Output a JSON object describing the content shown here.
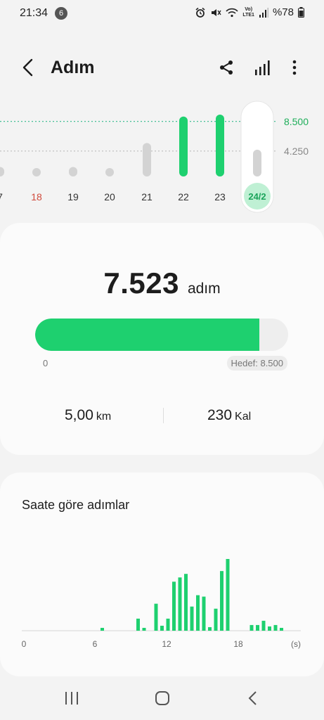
{
  "status_bar": {
    "time": "21:34",
    "notification_count": "6",
    "network_label_top": "Vo)",
    "network_label_bottom": "LTE1",
    "battery": "%78"
  },
  "header": {
    "title": "Adım",
    "icons": [
      "back-icon",
      "share-icon",
      "bar-chart-icon",
      "more-vert-icon"
    ]
  },
  "week_chart": {
    "goal_label": "8.500",
    "half_goal_label": "4.250",
    "days": [
      {
        "label": "7",
        "value": 1500,
        "color": "#d3d3d3",
        "label_color": "#333333"
      },
      {
        "label": "18",
        "value": 300,
        "color": "#d3d3d3",
        "label_color": "#d04a3c"
      },
      {
        "label": "19",
        "value": 1500,
        "color": "#d3d3d3",
        "label_color": "#333333"
      },
      {
        "label": "20",
        "value": 300,
        "color": "#d3d3d3",
        "label_color": "#333333"
      },
      {
        "label": "21",
        "value": 5300,
        "color": "#d3d3d3",
        "label_color": "#333333"
      },
      {
        "label": "22",
        "value": 9500,
        "color": "#1ed06f",
        "label_color": "#333333"
      },
      {
        "label": "23",
        "value": 9800,
        "color": "#1ed06f",
        "label_color": "#333333"
      }
    ],
    "selected": {
      "label": "24/2",
      "value": 5300
    }
  },
  "summary": {
    "steps": "7.523",
    "steps_unit": "adım",
    "progress_fraction": 0.885,
    "progress_min_label": "0",
    "progress_goal_label": "Hedef: 8.500",
    "distance_value": "5,00",
    "distance_unit": "km",
    "calories_value": "230",
    "calories_unit": "Kal"
  },
  "hourly": {
    "title": "Saate göre adımlar",
    "x_ticks": [
      "0",
      "6",
      "12",
      "18",
      "(s)"
    ],
    "bars": [
      {
        "hour": 6.5,
        "value": 4
      },
      {
        "hour": 9.5,
        "value": 17
      },
      {
        "hour": 10.0,
        "value": 4
      },
      {
        "hour": 11.0,
        "value": 38
      },
      {
        "hour": 11.5,
        "value": 7
      },
      {
        "hour": 12.0,
        "value": 17
      },
      {
        "hour": 12.5,
        "value": 69
      },
      {
        "hour": 13.0,
        "value": 75
      },
      {
        "hour": 13.5,
        "value": 80
      },
      {
        "hour": 14.0,
        "value": 34
      },
      {
        "hour": 14.5,
        "value": 50
      },
      {
        "hour": 15.0,
        "value": 48
      },
      {
        "hour": 15.5,
        "value": 5
      },
      {
        "hour": 16.0,
        "value": 31
      },
      {
        "hour": 16.5,
        "value": 84
      },
      {
        "hour": 17.0,
        "value": 101
      },
      {
        "hour": 19.0,
        "value": 8
      },
      {
        "hour": 19.5,
        "value": 8
      },
      {
        "hour": 20.0,
        "value": 14
      },
      {
        "hour": 20.5,
        "value": 6
      },
      {
        "hour": 21.0,
        "value": 8
      },
      {
        "hour": 21.5,
        "value": 4
      }
    ]
  },
  "nav": {
    "icons": [
      "recent-apps-icon",
      "home-icon",
      "back-nav-icon"
    ]
  },
  "colors": {
    "accent": "#1ed06f",
    "bar_inactive": "#d3d3d3",
    "goal_line": "#2fb98a"
  }
}
